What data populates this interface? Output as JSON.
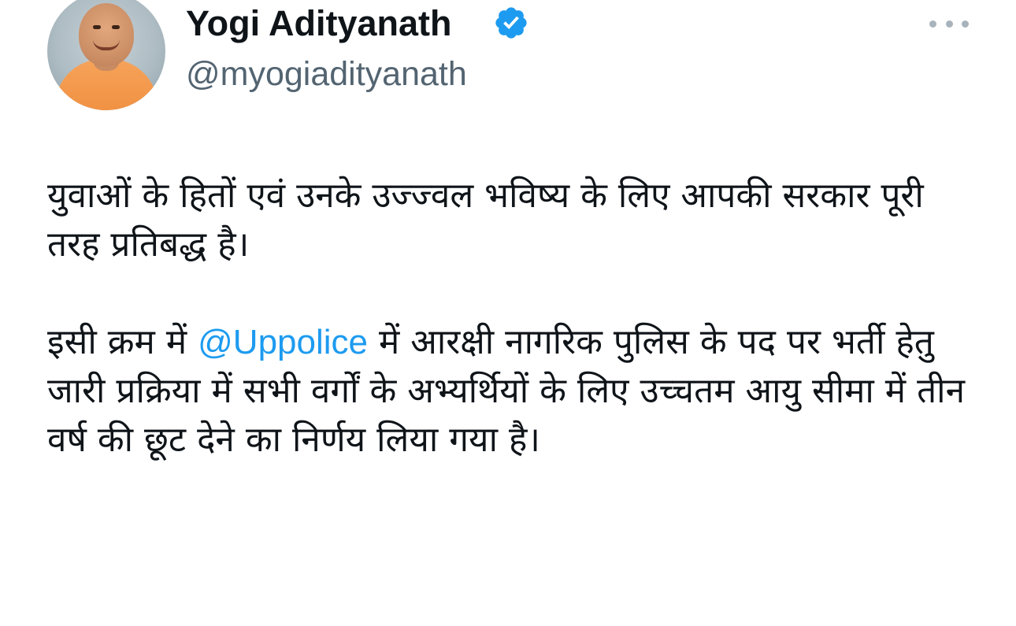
{
  "author": {
    "display_name": "Yogi Adityanath",
    "handle": "@myogiadityanath",
    "verified": true,
    "verified_color": "#1d9bf0"
  },
  "menu": {
    "icon": "more-horizontal-icon"
  },
  "tweet": {
    "paragraph1": "युवाओं के हितों एवं उनके उज्ज्वल भविष्य के लिए आपकी सरकार पूरी तरह प्रतिबद्ध है।",
    "paragraph2_before": "इसी क्रम में ",
    "mention": "@Uppolice",
    "paragraph2_after": " में आरक्षी नागरिक पुलिस के पद पर भर्ती हेतु जारी प्रक्रिया में सभी वर्गों के अभ्यर्थियों के लिए उच्चतम आयु सीमा में तीन वर्ष की छूट देने का निर्णय लिया गया है।",
    "mention_color": "#1d9bf0"
  }
}
